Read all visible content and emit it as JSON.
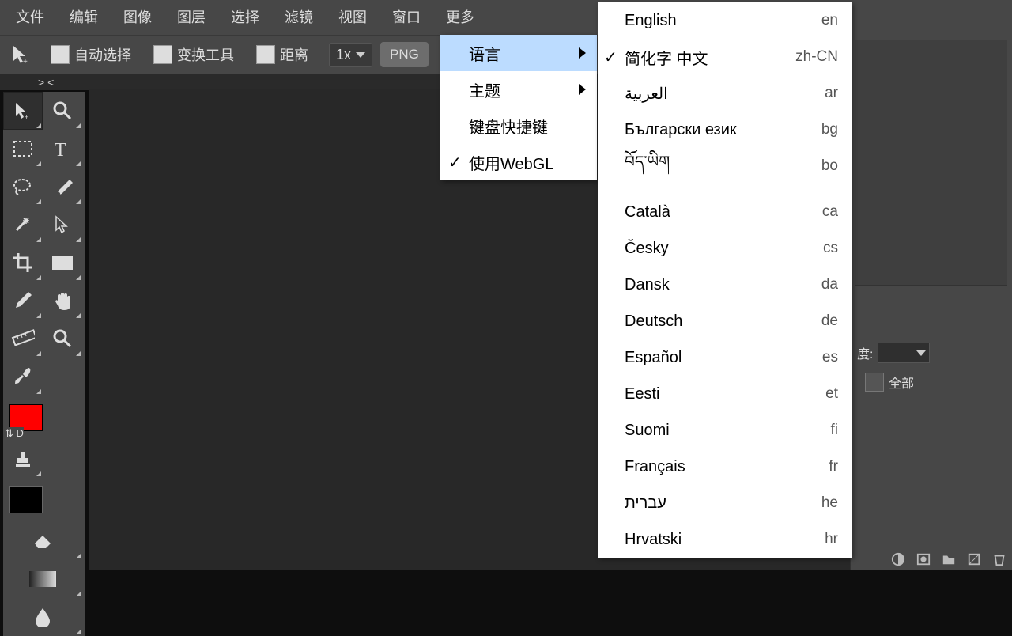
{
  "menu": {
    "file": "文件",
    "edit": "编辑",
    "image": "图像",
    "layer": "图层",
    "select": "选择",
    "filter": "滤镜",
    "view": "视图",
    "window": "窗口",
    "more": "更多"
  },
  "opt": {
    "autoSel": "自动选择",
    "transformTool": "变换工具",
    "distance": "距离",
    "zoom": "1x",
    "png": "PNG"
  },
  "tab": {
    "name": "> <"
  },
  "moreMenu": {
    "language": "语言",
    "theme": "主题",
    "keyboard": "键盘快捷键",
    "webgl": "使用WebGL",
    "check": "✓"
  },
  "langs": [
    {
      "name": "English",
      "code": "en",
      "checked": false
    },
    {
      "name": "简化字 中文",
      "code": "zh-CN",
      "checked": true
    },
    {
      "name": "العربية",
      "code": "ar",
      "checked": false
    },
    {
      "name": "Български език",
      "code": "bg",
      "checked": false
    },
    {
      "name": "བོད་ཡིག",
      "code": "bo",
      "checked": false,
      "gapAfter": true
    },
    {
      "name": "Català",
      "code": "ca",
      "checked": false
    },
    {
      "name": "Česky",
      "code": "cs",
      "checked": false
    },
    {
      "name": "Dansk",
      "code": "da",
      "checked": false
    },
    {
      "name": "Deutsch",
      "code": "de",
      "checked": false
    },
    {
      "name": "Español",
      "code": "es",
      "checked": false
    },
    {
      "name": "Eesti",
      "code": "et",
      "checked": false
    },
    {
      "name": "Suomi",
      "code": "fi",
      "checked": false
    },
    {
      "name": "Français",
      "code": "fr",
      "checked": false
    },
    {
      "name": "עברית",
      "code": "he",
      "checked": false
    },
    {
      "name": "Hrvatski",
      "code": "hr",
      "checked": false
    }
  ],
  "right": {
    "opacityLabel": "度:",
    "allLabel": "全部"
  },
  "colors": {
    "fg": "#ff0000",
    "bg": "#000000"
  },
  "swap": "⇅",
  "default": "D"
}
